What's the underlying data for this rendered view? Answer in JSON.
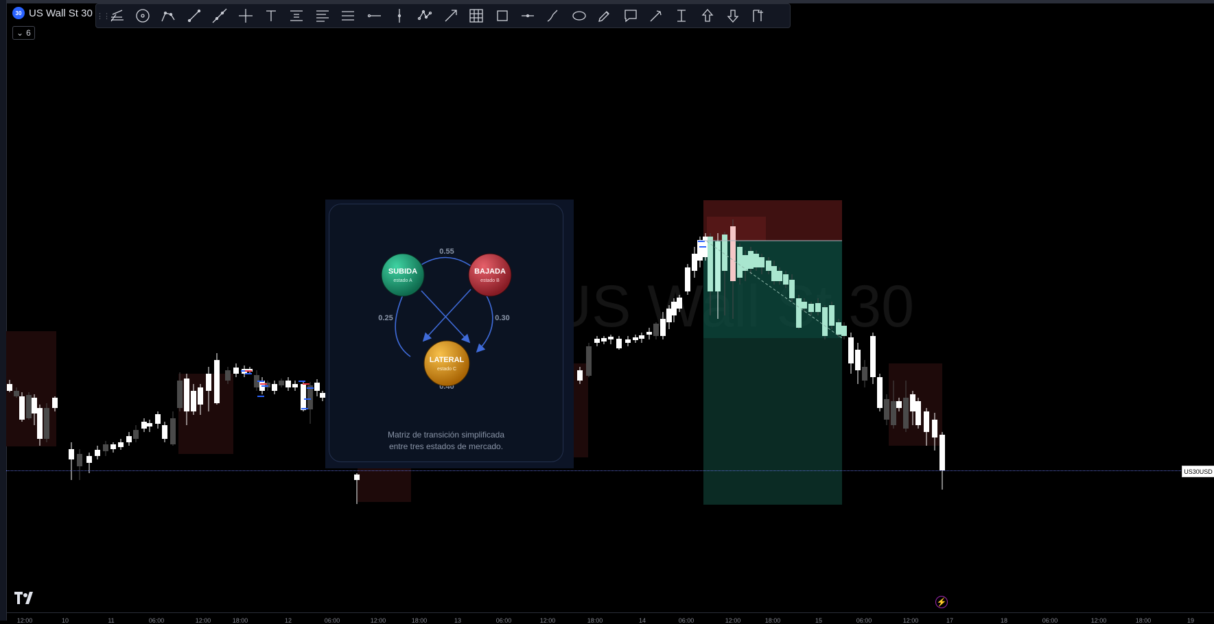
{
  "header": {
    "symbol_badge": "30",
    "symbol_name": "US Wall St 30",
    "interval_value": "6"
  },
  "toolbar": {
    "tools": [
      "trend-angle",
      "ellipse-circle",
      "curve",
      "line",
      "extended-line",
      "cross-line",
      "text",
      "price-label",
      "fib-retracement",
      "parallel-channel",
      "horizontal-ray",
      "vertical-line",
      "polyline-path",
      "arrow-line",
      "gann-grid",
      "rectangle",
      "info-line",
      "brush",
      "ellipse",
      "highlighter",
      "callout",
      "arrow-marker",
      "price-range",
      "arrow-up",
      "arrow-down",
      "flag"
    ]
  },
  "chart": {
    "watermark": "US Wall St 30",
    "price_tag": "US30USD",
    "time_labels": [
      "12:00",
      "10",
      "11",
      "06:00",
      "12:00",
      "18:00",
      "12",
      "06:00",
      "12:00",
      "18:00",
      "13",
      "06:00",
      "12:00",
      "18:00",
      "14",
      "06:00",
      "12:00",
      "18:00",
      "15",
      "06:00",
      "12:00",
      "17",
      "18",
      "06:00",
      "12:00",
      "18:00",
      "19"
    ],
    "colors": {
      "up_candle": "#ffffff",
      "down_candle": "#4a4a4a",
      "highlight_zone": "#1e0a0a",
      "target_zone": "#0e4a3e",
      "stop_zone": "#4a1414",
      "price_line": "#5b6bd6"
    }
  },
  "diagram": {
    "states": [
      {
        "name": "SUBIDA",
        "sub": "estado A",
        "color": "#1f9e74"
      },
      {
        "name": "BAJADA",
        "sub": "estado B",
        "color": "#c0353d"
      },
      {
        "name": "LATERAL",
        "sub": "estado C",
        "color": "#e49a17"
      }
    ],
    "probabilities": {
      "top": "0.55",
      "left": "0.25",
      "right": "0.30",
      "bottom": "0.40"
    },
    "caption_line1": "Matriz de transición simplificada",
    "caption_line2": "entre tres estados de mercado."
  }
}
